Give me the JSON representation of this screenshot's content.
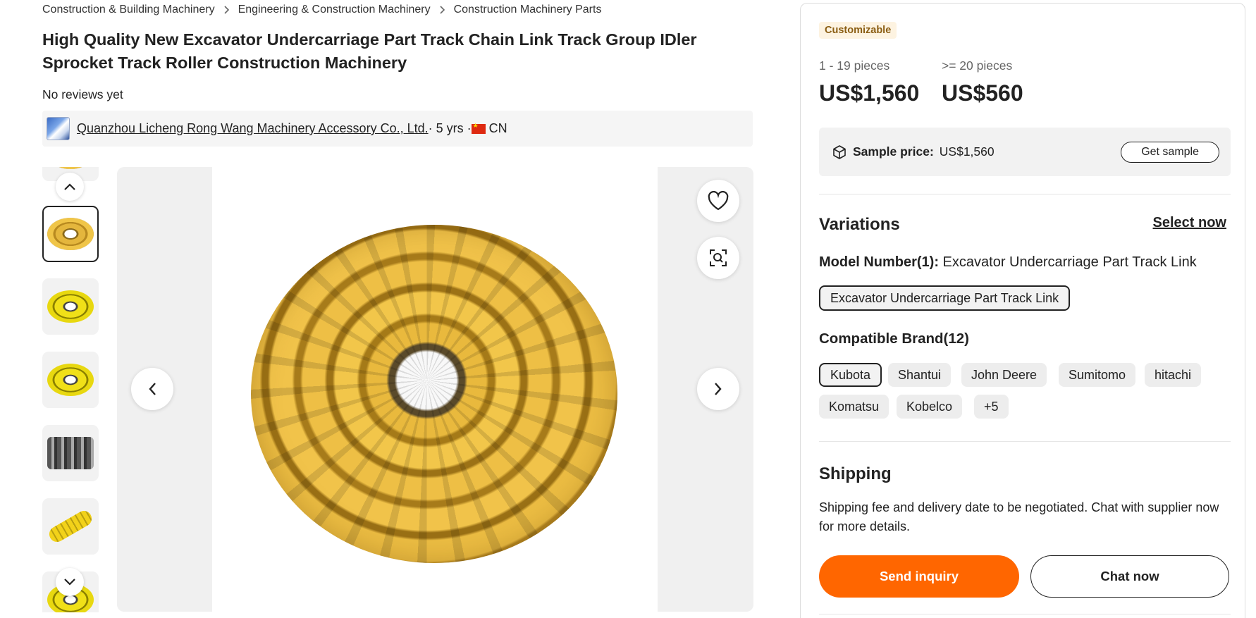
{
  "breadcrumb": {
    "items": [
      "Construction & Building Machinery",
      "Engineering & Construction Machinery",
      "Construction Machinery Parts"
    ]
  },
  "product": {
    "title": "High Quality New Excavator Undercarriage Part Track Chain Link Track Group IDler Sprocket Track Roller Construction Machinery",
    "reviews": "No reviews yet"
  },
  "supplier": {
    "name": "Quanzhou Licheng Rong Wang Machinery Accessory Co., Ltd.",
    "years": " · 5 yrs · ",
    "country": "CN"
  },
  "gallery": {
    "thumb_count": 7,
    "active_index": 1
  },
  "purchase": {
    "badge": "Customizable",
    "tiers": [
      {
        "qty": "1 - 19 pieces",
        "price": "US$1,560"
      },
      {
        "qty": ">= 20 pieces",
        "price": "US$560"
      }
    ],
    "sample": {
      "label": "Sample price:",
      "price": "US$1,560",
      "button": "Get sample"
    }
  },
  "variations": {
    "title": "Variations",
    "select_now": "Select now",
    "model_label": "Model Number(1):",
    "model_value": " Excavator Undercarriage Part Track Link",
    "model_options": [
      "Excavator Undercarriage Part Track Link"
    ],
    "brand_label": "Compatible Brand(12)",
    "brands": [
      "Kubota",
      "Shantui",
      "John Deere",
      "Sumitomo",
      "hitachi",
      "Komatsu",
      "Kobelco",
      "+5"
    ]
  },
  "shipping": {
    "title": "Shipping",
    "text": "Shipping fee and delivery date to be negotiated. Chat with supplier now for more details."
  },
  "actions": {
    "send_inquiry": "Send inquiry",
    "chat_now": "Chat now"
  },
  "colors": {
    "accent": "#ff6600",
    "badge_bg": "#fdf3e1",
    "badge_text": "#8a5d12"
  }
}
